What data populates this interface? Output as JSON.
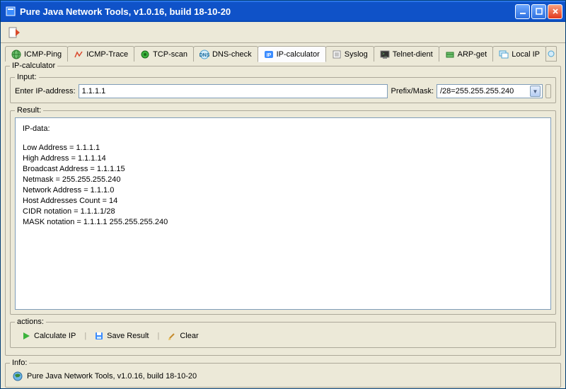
{
  "window": {
    "title": "Pure Java Network Tools,  v1.0.16, build 18-10-20"
  },
  "tabs": [
    {
      "label": "ICMP-Ping"
    },
    {
      "label": "ICMP-Trace"
    },
    {
      "label": "TCP-scan"
    },
    {
      "label": "DNS-check"
    },
    {
      "label": "IP-calculator"
    },
    {
      "label": "Syslog"
    },
    {
      "label": "Telnet-dient"
    },
    {
      "label": "ARP-get"
    },
    {
      "label": "Local IP"
    }
  ],
  "panel": {
    "legend": "IP-calculator",
    "input_legend": "Input:",
    "ip_label": "Enter IP-address:",
    "ip_value": "1.1.1.1",
    "mask_label": "Prefix/Mask:",
    "mask_value": "/28=255.255.255.240",
    "result_legend": "Result:",
    "result_header": "IP-data:",
    "results": {
      "low": "Low Address = 1.1.1.1",
      "high": "High Address = 1.1.1.14",
      "broadcast": "Broadcast Address = 1.1.1.15",
      "netmask": "Netmask = 255.255.255.240",
      "network": "Network Address = 1.1.1.0",
      "hostcount": "Host Addresses Count = 14",
      "cidr": "CIDR notation = 1.1.1.1/28",
      "maskn": "MASK notation = 1.1.1.1 255.255.255.240"
    },
    "actions_legend": "actions:",
    "calc_label": "Calculate IP",
    "save_label": "Save Result",
    "clear_label": "Clear"
  },
  "info": {
    "legend": "Info:",
    "text": "Pure Java Network Tools,  v1.0.16, build 18-10-20"
  }
}
